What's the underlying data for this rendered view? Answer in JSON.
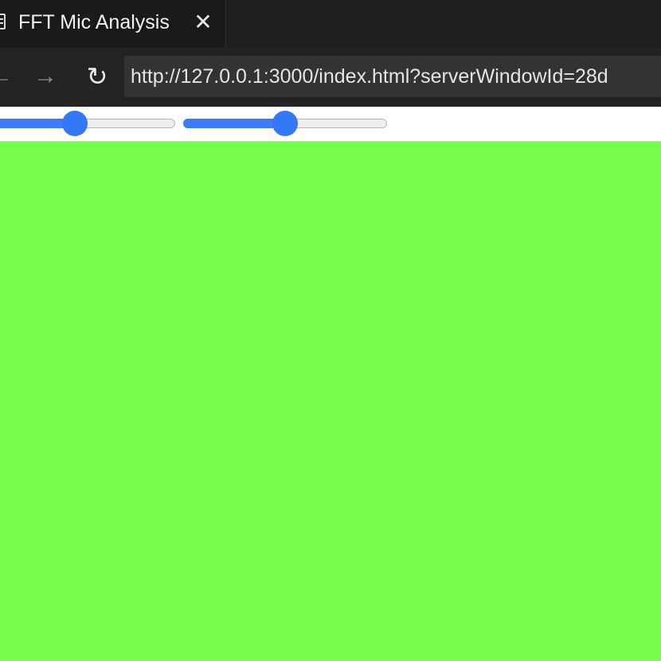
{
  "tab": {
    "title": "FFT Mic Analysis",
    "close_glyph": "✕",
    "icon": "document-icon"
  },
  "nav": {
    "back_glyph": "←",
    "forward_glyph": "→",
    "reload_glyph": "↻",
    "url": "http://127.0.0.1:3000/index.html?serverWindowId=28d"
  },
  "controls": {
    "slider_1": {
      "value_fraction": 0.45
    },
    "slider_2": {
      "value_fraction": 0.5
    }
  },
  "canvas": {
    "color": "#76fd4e"
  },
  "colors": {
    "accent": "#3478f6",
    "chrome": "#1e1e1e",
    "canvas": "#76fd4e"
  }
}
